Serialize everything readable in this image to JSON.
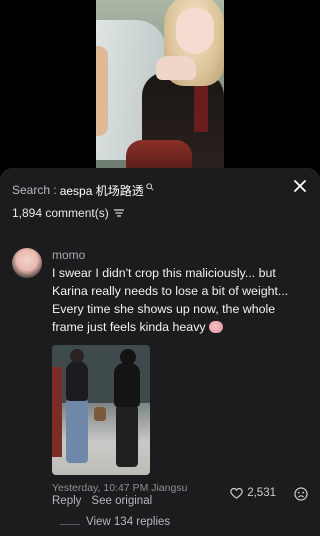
{
  "search": {
    "prefix": "Search :",
    "term": "aespa 机场路透"
  },
  "comments": {
    "count_label": "1,894 comment(s)"
  },
  "comment": {
    "username": "momo",
    "text": "I swear I didn't crop this maliciously... but Karina really needs to lose a bit of weight... Every time she shows up now, the whole frame just feels kinda heavy",
    "timestamp": "Yesterday, 10:47 PM Jiangsu",
    "reply_label": "Reply",
    "see_original_label": "See original",
    "likes": "2,531",
    "view_replies_label": "View 134 replies"
  },
  "icons": {
    "close": "close-icon",
    "sort": "sort-icon",
    "heart": "heart-icon",
    "dislike": "dislike-icon",
    "search_mini": "search-icon"
  },
  "colors": {
    "panel_bg": "#1c1c1e",
    "text_primary": "#f1f1f3",
    "text_secondary": "#8e8e93"
  }
}
